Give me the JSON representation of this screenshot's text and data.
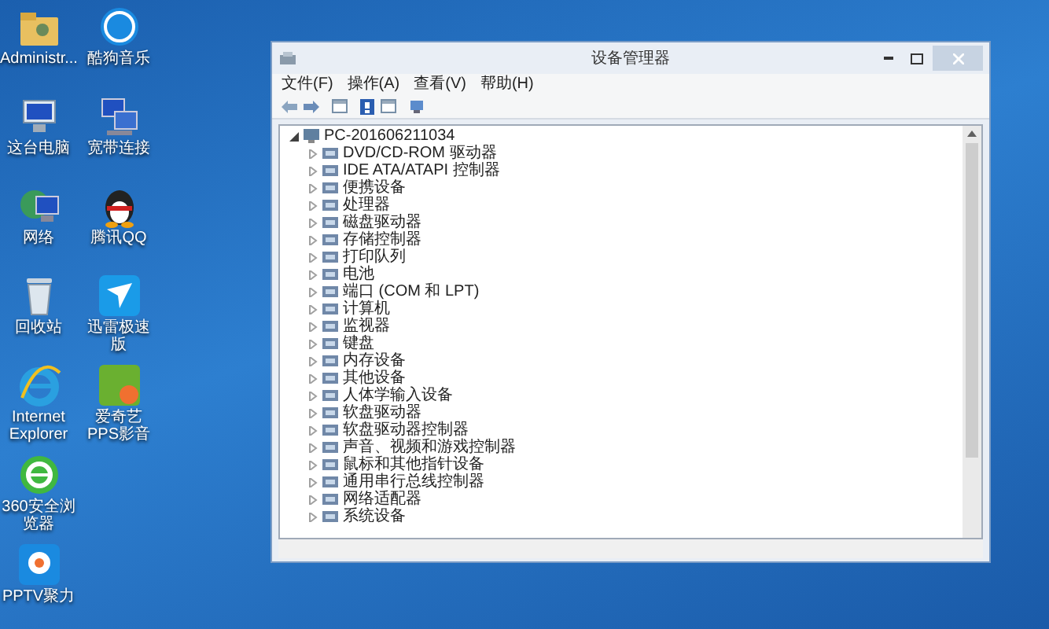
{
  "desktop_icons": [
    {
      "label": "Administr...",
      "kind": "folder"
    },
    {
      "label": "这台电脑",
      "kind": "computer"
    },
    {
      "label": "网络",
      "kind": "globe"
    },
    {
      "label": "回收站",
      "kind": "trash"
    },
    {
      "label": "Internet Explorer",
      "kind": "ie"
    },
    {
      "label": "360安全浏览器",
      "kind": "browser"
    },
    {
      "label": "PPTV聚力",
      "kind": "player"
    },
    {
      "label": "酷狗音乐",
      "kind": "music"
    },
    {
      "label": "宽带连接",
      "kind": "network"
    },
    {
      "label": "腾讯QQ",
      "kind": "penguin"
    },
    {
      "label": "迅雷极速版",
      "kind": "bird"
    },
    {
      "label": "爱奇艺PPS影音",
      "kind": "video"
    }
  ],
  "window": {
    "title": "设备管理器",
    "menu": [
      "文件(F)",
      "操作(A)",
      "查看(V)",
      "帮助(H)"
    ],
    "tree": {
      "label": "PC-201606211034",
      "expanded": true,
      "children": [
        {
          "label": "DVD/CD-ROM 驱动器",
          "expanded": false
        },
        {
          "label": "IDE ATA/ATAPI 控制器",
          "expanded": false
        },
        {
          "label": "便携设备",
          "expanded": false
        },
        {
          "label": "处理器",
          "expanded": false
        },
        {
          "label": "磁盘驱动器",
          "expanded": false
        },
        {
          "label": "存储控制器",
          "expanded": false
        },
        {
          "label": "打印队列",
          "expanded": false
        },
        {
          "label": "电池",
          "expanded": false
        },
        {
          "label": "端口 (COM 和 LPT)",
          "expanded": false
        },
        {
          "label": "计算机",
          "expanded": false
        },
        {
          "label": "监视器",
          "expanded": false
        },
        {
          "label": "键盘",
          "expanded": false
        },
        {
          "label": "内存设备",
          "expanded": false
        },
        {
          "label": "其他设备",
          "expanded": false
        },
        {
          "label": "人体学输入设备",
          "expanded": false
        },
        {
          "label": "软盘驱动器",
          "expanded": false
        },
        {
          "label": "软盘驱动器控制器",
          "expanded": false
        },
        {
          "label": "声音、视频和游戏控制器",
          "expanded": false
        },
        {
          "label": "鼠标和其他指针设备",
          "expanded": false
        },
        {
          "label": "通用串行总线控制器",
          "expanded": false
        },
        {
          "label": "网络适配器",
          "expanded": false
        },
        {
          "label": "系统设备",
          "expanded": false
        }
      ]
    }
  }
}
